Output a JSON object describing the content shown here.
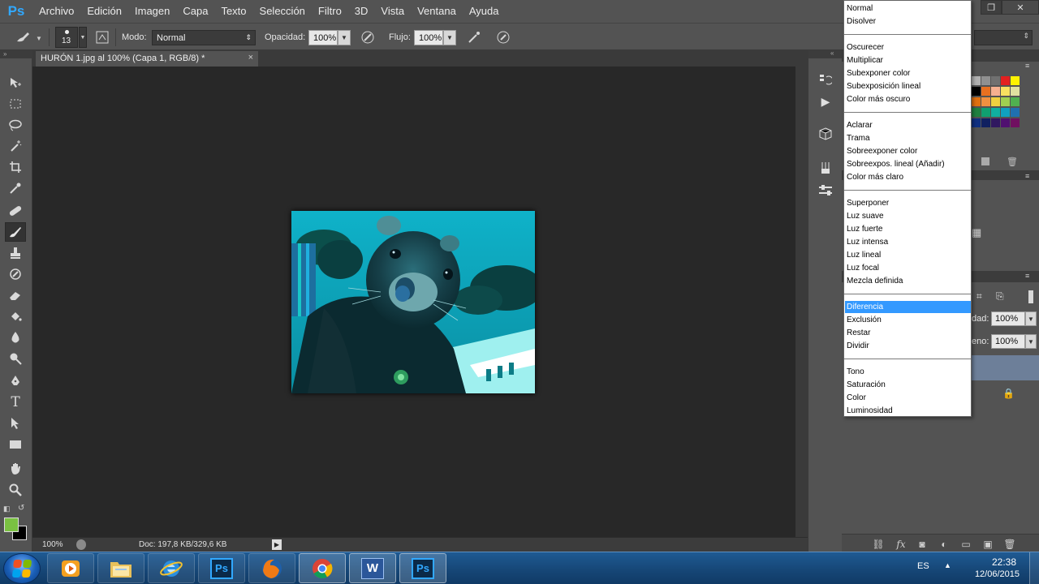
{
  "app": {
    "logo": "Ps"
  },
  "menubar": {
    "items": [
      "Archivo",
      "Edición",
      "Imagen",
      "Capa",
      "Texto",
      "Selección",
      "Filtro",
      "3D",
      "Vista",
      "Ventana",
      "Ayuda"
    ]
  },
  "window_controls": {
    "restore": "❐",
    "close": "✕"
  },
  "options_bar": {
    "brush_size": "13",
    "mode_label": "Modo:",
    "mode_value": "Normal",
    "opacity_label": "Opacidad:",
    "opacity_value": "100%",
    "flow_label": "Flujo:",
    "flow_value": "100%"
  },
  "document": {
    "tab_title": "HURÓN 1.jpg al 100% (Capa 1, RGB/8) *",
    "tab_close": "×",
    "image_subject": "ferret photo with cyan tint"
  },
  "status_bar": {
    "zoom": "100%",
    "doc_info": "Doc: 197,8 KB/329,6 KB"
  },
  "tools": [
    "move-tool",
    "marquee-tool",
    "lasso-tool",
    "magic-wand-tool",
    "crop-tool",
    "eyedropper-tool",
    "healing-brush-tool",
    "brush-tool",
    "clone-stamp-tool",
    "history-brush-tool",
    "eraser-tool",
    "paint-bucket-tool",
    "blur-tool",
    "dodge-tool",
    "pen-tool",
    "type-tool",
    "path-selection-tool",
    "rectangle-tool",
    "hand-tool",
    "zoom-tool"
  ],
  "colors": {
    "foreground": "#7ac142",
    "background": "#000000",
    "selection": "#3399ff"
  },
  "layers_panel": {
    "opacity_label_partial": "dad:",
    "opacity_value": "100%",
    "fill_label_partial": "eno:",
    "fill_value": "100%"
  },
  "blend_menu": {
    "groups": [
      [
        "Normal",
        "Disolver"
      ],
      [
        "Oscurecer",
        "Multiplicar",
        "Subexponer color",
        "Subexposición lineal",
        "Color más oscuro"
      ],
      [
        "Aclarar",
        "Trama",
        "Sobreexponer color",
        "Sobreexpos. lineal (Añadir)",
        "Color más claro"
      ],
      [
        "Superponer",
        "Luz suave",
        "Luz fuerte",
        "Luz intensa",
        "Luz lineal",
        "Luz focal",
        "Mezcla definida"
      ],
      [
        "Diferencia",
        "Exclusión",
        "Restar",
        "Dividir"
      ],
      [
        "Tono",
        "Saturación",
        "Color",
        "Luminosidad"
      ]
    ],
    "selected": "Diferencia"
  },
  "taskbar": {
    "apps": [
      "media-player",
      "file-explorer",
      "internet-explorer",
      "photoshop-pinned",
      "firefox",
      "chrome",
      "word",
      "photoshop-running"
    ],
    "ps_label": "Ps",
    "word_label": "W",
    "language": "ES",
    "time": "22:38",
    "date": "12/06/2015"
  }
}
